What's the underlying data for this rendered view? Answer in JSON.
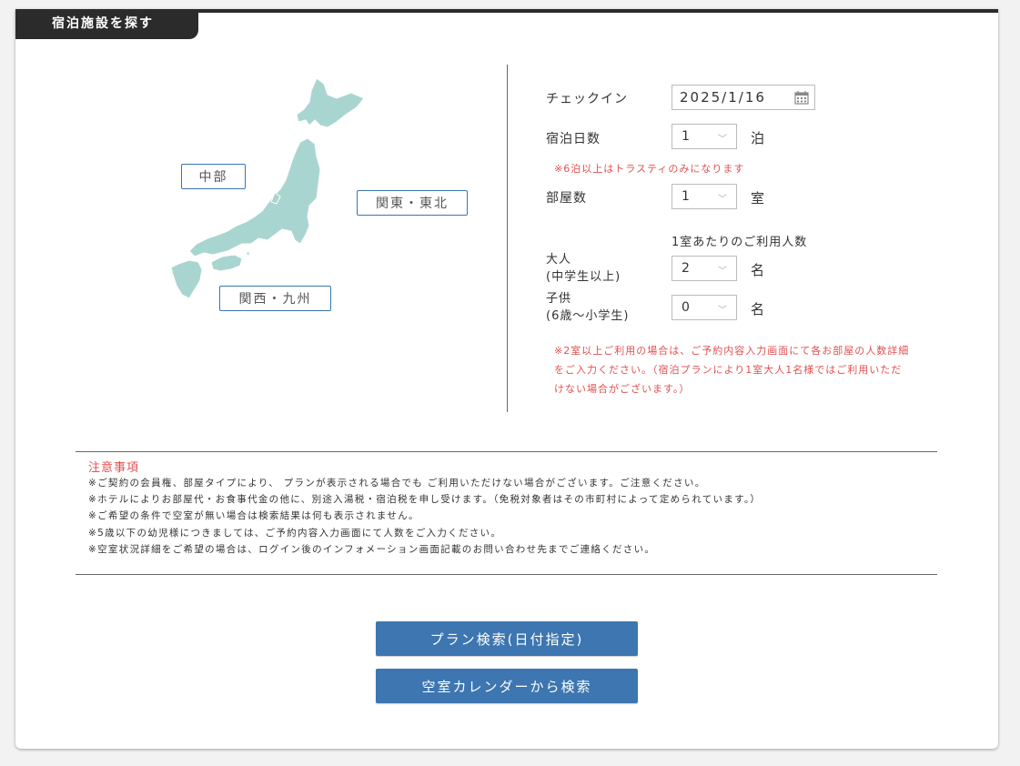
{
  "header": {
    "tab_title": "宿泊施設を探す"
  },
  "map": {
    "regions": {
      "chubu": "中部",
      "kanto_tohoku": "関東・東北",
      "kansai_kyushu": "関西・九州"
    },
    "map_color": "#a9d5d1"
  },
  "form": {
    "checkin": {
      "label": "チェックイン",
      "value": "2025/1/16"
    },
    "nights": {
      "label": "宿泊日数",
      "value": "1",
      "unit": "泊",
      "note": "※6泊以上はトラスティのみになります"
    },
    "rooms": {
      "label": "部屋数",
      "value": "1",
      "unit": "室"
    },
    "per_room_caption": "1室あたりのご利用人数",
    "adults": {
      "label_line1": "大人",
      "label_line2": "(中学生以上)",
      "value": "2",
      "unit": "名"
    },
    "children": {
      "label_line1": "子供",
      "label_line2": "(6歳～小学生)",
      "value": "0",
      "unit": "名"
    },
    "multi_room_note": [
      "※2室以上ご利用の場合は、ご予約内容入力画面にて各お部屋の人数詳細",
      "をご入力ください。（宿泊プランにより1室大人1名様ではご利用いただ",
      "けない場合がございます。）"
    ]
  },
  "notices": {
    "title": "注意事項",
    "items": [
      "※ご契約の会員権、部屋タイプにより、 プランが表示される場合でも ご利用いただけない場合がございます。ご注意ください。",
      "※ホテルによりお部屋代・お食事代金の他に、別途入湯税・宿泊税を申し受けます。（免税対象者はその市町村によって定められています。）",
      "※ご希望の条件で空室が無い場合は検索結果は何も表示されません。",
      "※5歳以下の幼児様につきましては、ご予約内容入力画面にて人数をご入力ください。",
      "※空室状況詳細をご希望の場合は、ログイン後のインフォメーション画面記載のお問い合わせ先までご連絡ください。"
    ]
  },
  "buttons": {
    "plan_search": "プラン検索(日付指定)",
    "calendar_search": "空室カレンダーから検索"
  },
  "colors": {
    "accent": "#3d76b0",
    "note_red": "#e05050",
    "header_dark": "#2b2b2b"
  }
}
